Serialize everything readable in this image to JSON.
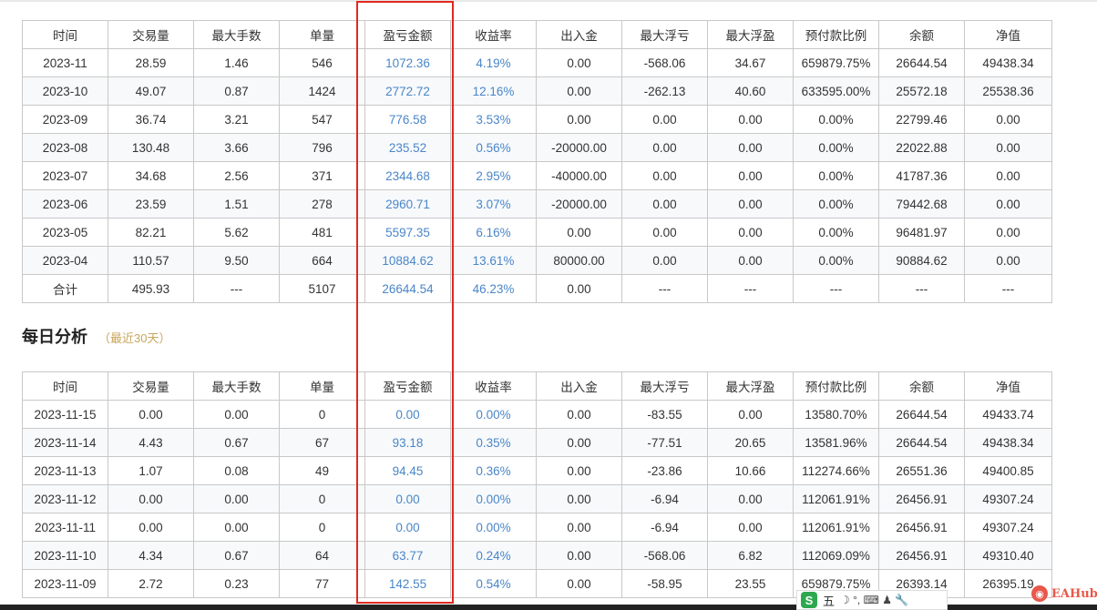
{
  "headers": [
    "时间",
    "交易量",
    "最大手数",
    "单量",
    "盈亏金额",
    "收益率",
    "出入金",
    "最大浮亏",
    "最大浮盈",
    "预付款比例",
    "余额",
    "净值"
  ],
  "monthly_rows": [
    [
      "2023-11",
      "28.59",
      "1.46",
      "546",
      "1072.36",
      "4.19%",
      "0.00",
      "-568.06",
      "34.67",
      "659879.75%",
      "26644.54",
      "49438.34"
    ],
    [
      "2023-10",
      "49.07",
      "0.87",
      "1424",
      "2772.72",
      "12.16%",
      "0.00",
      "-262.13",
      "40.60",
      "633595.00%",
      "25572.18",
      "25538.36"
    ],
    [
      "2023-09",
      "36.74",
      "3.21",
      "547",
      "776.58",
      "3.53%",
      "0.00",
      "0.00",
      "0.00",
      "0.00%",
      "22799.46",
      "0.00"
    ],
    [
      "2023-08",
      "130.48",
      "3.66",
      "796",
      "235.52",
      "0.56%",
      "-20000.00",
      "0.00",
      "0.00",
      "0.00%",
      "22022.88",
      "0.00"
    ],
    [
      "2023-07",
      "34.68",
      "2.56",
      "371",
      "2344.68",
      "2.95%",
      "-40000.00",
      "0.00",
      "0.00",
      "0.00%",
      "41787.36",
      "0.00"
    ],
    [
      "2023-06",
      "23.59",
      "1.51",
      "278",
      "2960.71",
      "3.07%",
      "-20000.00",
      "0.00",
      "0.00",
      "0.00%",
      "79442.68",
      "0.00"
    ],
    [
      "2023-05",
      "82.21",
      "5.62",
      "481",
      "5597.35",
      "6.16%",
      "0.00",
      "0.00",
      "0.00",
      "0.00%",
      "96481.97",
      "0.00"
    ],
    [
      "2023-04",
      "110.57",
      "9.50",
      "664",
      "10884.62",
      "13.61%",
      "80000.00",
      "0.00",
      "0.00",
      "0.00%",
      "90884.62",
      "0.00"
    ],
    [
      "合计",
      "495.93",
      "---",
      "5107",
      "26644.54",
      "46.23%",
      "0.00",
      "---",
      "---",
      "---",
      "---",
      "---"
    ]
  ],
  "section": {
    "title": "每日分析",
    "subtitle": "（最近30天）"
  },
  "daily_rows": [
    [
      "2023-11-15",
      "0.00",
      "0.00",
      "0",
      "0.00",
      "0.00%",
      "0.00",
      "-83.55",
      "0.00",
      "13580.70%",
      "26644.54",
      "49433.74"
    ],
    [
      "2023-11-14",
      "4.43",
      "0.67",
      "67",
      "93.18",
      "0.35%",
      "0.00",
      "-77.51",
      "20.65",
      "13581.96%",
      "26644.54",
      "49438.34"
    ],
    [
      "2023-11-13",
      "1.07",
      "0.08",
      "49",
      "94.45",
      "0.36%",
      "0.00",
      "-23.86",
      "10.66",
      "112274.66%",
      "26551.36",
      "49400.85"
    ],
    [
      "2023-11-12",
      "0.00",
      "0.00",
      "0",
      "0.00",
      "0.00%",
      "0.00",
      "-6.94",
      "0.00",
      "112061.91%",
      "26456.91",
      "49307.24"
    ],
    [
      "2023-11-11",
      "0.00",
      "0.00",
      "0",
      "0.00",
      "0.00%",
      "0.00",
      "-6.94",
      "0.00",
      "112061.91%",
      "26456.91",
      "49307.24"
    ],
    [
      "2023-11-10",
      "4.34",
      "0.67",
      "64",
      "63.77",
      "0.24%",
      "0.00",
      "-568.06",
      "6.82",
      "112069.09%",
      "26456.91",
      "49310.40"
    ],
    [
      "2023-11-09",
      "2.72",
      "0.23",
      "77",
      "142.55",
      "0.54%",
      "0.00",
      "-58.95",
      "23.55",
      "659879.75%",
      "26393.14",
      "26395.19"
    ]
  ],
  "colors": {
    "link_blue": "#4a86c8",
    "highlight_red": "#e0291f",
    "subtitle_gold": "#c9a55a"
  },
  "ime": {
    "logo": "S",
    "mode": "五",
    "glyphs": "☽ °, ⌨ ♟ 🔧"
  },
  "watermark": {
    "text": "EAHub"
  }
}
